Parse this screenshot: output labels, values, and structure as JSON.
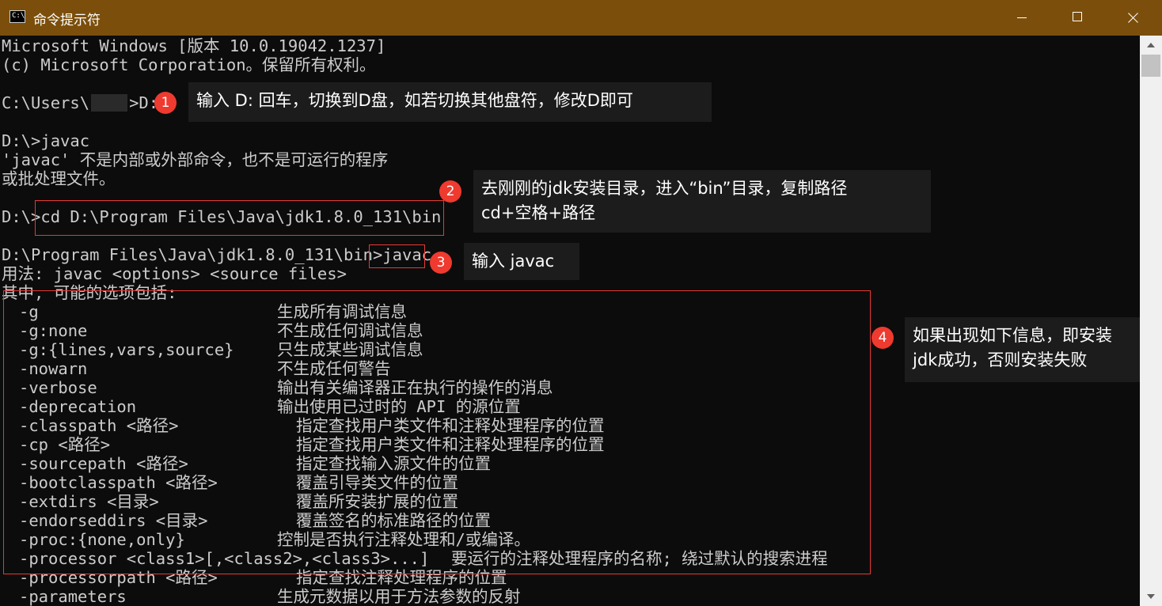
{
  "window": {
    "title": "命令提示符",
    "icon": "cmd-icon",
    "icon_text": "C:\\"
  },
  "console": {
    "header1": "Microsoft Windows [版本 10.0.19042.1237]",
    "header2": "(c) Microsoft Corporation。保留所有权利。",
    "prompt1_a": "C:\\Users\\",
    "prompt1_b": ">D:",
    "prompt2": "D:\\>javac",
    "err1": "'javac' 不是内部或外部命令，也不是可运行的程序",
    "err2": "或批处理文件。",
    "prompt3_a": "D:\\>",
    "prompt3_b": "cd D:\\Program Files\\Java\\jdk1.8.0_131\\bin",
    "prompt4_a": "D:\\Program Files\\Java\\jdk1.8.0_131\\bin>",
    "prompt4_b": "javac",
    "usage": "用法: javac <options> <source files>",
    "options_header": "其中, 可能的选项包括:",
    "options": [
      {
        "opt": "-g",
        "desc": "生成所有调试信息"
      },
      {
        "opt": "-g:none",
        "desc": "不生成任何调试信息"
      },
      {
        "opt": "-g:{lines,vars,source}",
        "desc": "只生成某些调试信息"
      },
      {
        "opt": "-nowarn",
        "desc": "不生成任何警告"
      },
      {
        "opt": "-verbose",
        "desc": "输出有关编译器正在执行的操作的消息"
      },
      {
        "opt": "-deprecation",
        "desc": "输出使用已过时的 API 的源位置"
      },
      {
        "opt": "-classpath <路径>",
        "desc": "指定查找用户类文件和注释处理程序的位置"
      },
      {
        "opt": "-cp <路径>",
        "desc": "指定查找用户类文件和注释处理程序的位置"
      },
      {
        "opt": "-sourcepath <路径>",
        "desc": "指定查找输入源文件的位置"
      },
      {
        "opt": "-bootclasspath <路径>",
        "desc": "覆盖引导类文件的位置"
      },
      {
        "opt": "-extdirs <目录>",
        "desc": "覆盖所安装扩展的位置"
      },
      {
        "opt": "-endorseddirs <目录>",
        "desc": "覆盖签名的标准路径的位置"
      },
      {
        "opt": "-proc:{none,only}",
        "desc": "控制是否执行注释处理和/或编译。"
      },
      {
        "opt": "-processor <class1>[,<class2>,<class3>...]",
        "desc": "要运行的注释处理程序的名称; 绕过默认的搜索进程"
      },
      {
        "opt": "-processorpath <路径>",
        "desc": "指定查找注释处理程序的位置"
      },
      {
        "opt": "-parameters",
        "desc": "生成元数据以用于方法参数的反射"
      }
    ]
  },
  "annotations": [
    {
      "number": "1",
      "lines": [
        "输入 D: 回车，切换到D盘，如若切换其他盘符，修改D即可"
      ]
    },
    {
      "number": "2",
      "lines": [
        "去刚刚的jdk安装目录，进入“bin”目录，复制路径",
        "cd+空格+路径"
      ]
    },
    {
      "number": "3",
      "lines": [
        "输入 javac"
      ]
    },
    {
      "number": "4",
      "lines": [
        "如果出现如下信息，即安装",
        "jdk成功，否则安装失败"
      ]
    }
  ],
  "colors": {
    "titlebar": "#7b4f0b",
    "console_bg": "#0c0c0c",
    "console_text": "#cccccc",
    "annotation_red": "#ef3a2f"
  }
}
